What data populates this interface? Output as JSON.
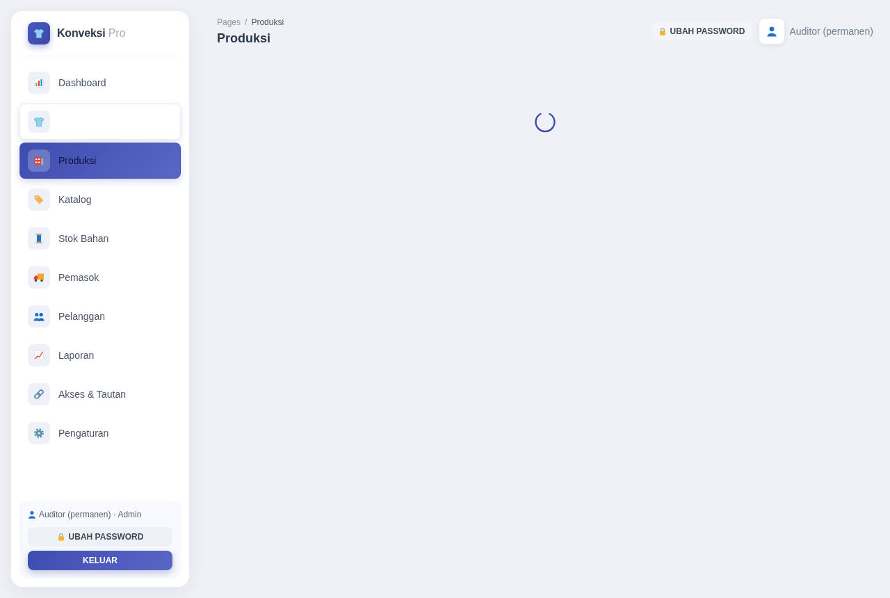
{
  "sidebar": {
    "brand": {
      "name": "Konveksi",
      "suffix": "Pro"
    },
    "items": [
      {
        "label": "Dashboard",
        "selected": false,
        "hovered": false
      },
      {
        "selected": false,
        "hovered": true
      },
      {
        "label": "Produksi",
        "selected": true,
        "hovered": false
      },
      {
        "label": "Katalog",
        "selected": false,
        "hovered": false
      },
      {
        "label": "Stok Bahan",
        "selected": false,
        "hovered": false
      },
      {
        "label": "Pemasok",
        "selected": false,
        "hovered": false
      },
      {
        "label": "Pelanggan",
        "selected": false,
        "hovered": false
      },
      {
        "label": "Laporan",
        "selected": false,
        "hovered": false
      },
      {
        "label": "Akses & Tautan",
        "selected": false,
        "hovered": false
      },
      {
        "label": "Pengaturan",
        "selected": false,
        "hovered": false
      }
    ],
    "user_panel": {
      "user": "Auditor (permanen) · Admin",
      "buttons": [
        {
          "label": "UBAH PASSWORD",
          "kind": "password"
        },
        {
          "label": "KELUAR",
          "kind": "logout"
        }
      ]
    }
  },
  "header": {
    "breadcrumb": {
      "items": [
        "Pages",
        "Produksi"
      ],
      "separator": "/"
    },
    "title": "Produksi",
    "password_button": "UBAH PASSWORD",
    "user_name": "Auditor (permanen)"
  },
  "content": {
    "loading": true
  }
}
